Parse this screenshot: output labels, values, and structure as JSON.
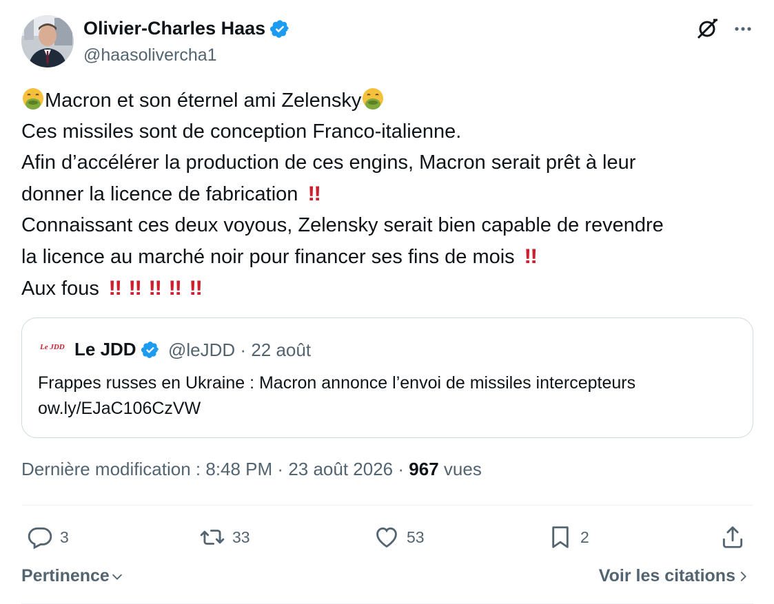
{
  "colors": {
    "text_primary": "#0f1419",
    "text_secondary": "#536471",
    "verified_blue": "#1d9bf0",
    "border": "#cfd9de",
    "bangbang_red": "#cc1f2f",
    "jdd_red": "#d0202e"
  },
  "author": {
    "display_name": "Olivier-Charles Haas",
    "handle": "@haasolivercha1",
    "verified": true,
    "avatar_icon": "profile-photo"
  },
  "tweet": {
    "lines": [
      "Macron et son éternel ami Zelensky",
      "Ces missiles sont de conception Franco-italienne.",
      "Afin d’accélérer la production de ces engins, Macron serait prêt à leur",
      "donner la licence de fabrication",
      "Connaissant ces deux voyous, Zelensky serait bien capable de revendre",
      "la licence au marché noir pour financer ses fins de mois",
      "Aux fous"
    ],
    "emoji_name": "nauseated-face",
    "bangbang": "‼",
    "bangbang_line_4": "‼",
    "bangbang_line_6": "‼",
    "bangbang_line_7": [
      "‼",
      "‼",
      "‼",
      "‼",
      "‼"
    ]
  },
  "quote": {
    "logo_text": "Le JDD",
    "name": "Le JDD",
    "verified": true,
    "handle": "@leJDD",
    "separator": "·",
    "date": "22 août",
    "text": "Frappes russes en Ukraine : Macron annonce l’envoi de missiles intercepteurs",
    "link": "ow.ly/EJaC106CzVW"
  },
  "meta": {
    "edited_label": "Dernière modification :",
    "time": "8:48 PM",
    "separator": "·",
    "date": "23 août 2026",
    "views_count": "967",
    "views_label": "vues"
  },
  "actions": {
    "replies": "3",
    "reposts": "33",
    "likes": "53",
    "bookmarks": "2"
  },
  "footer": {
    "sort_label": "Pertinence",
    "quotes_label": "Voir les citations"
  }
}
